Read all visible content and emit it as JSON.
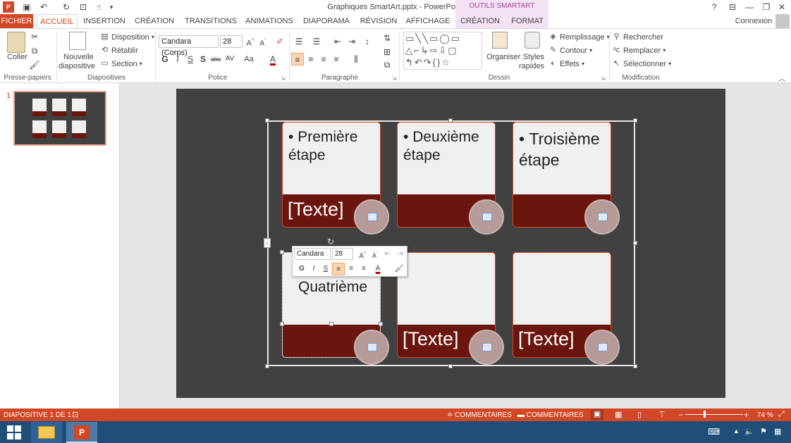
{
  "window": {
    "title": "Graphiques SmartArt.pptx - PowerPoint",
    "help": "?",
    "signin": "Connexion"
  },
  "tabs": {
    "file": "FICHIER",
    "home": "ACCUEIL",
    "insert": "INSERTION",
    "design": "CRÉATION",
    "transitions": "TRANSITIONS",
    "animations": "ANIMATIONS",
    "slideshow": "DIAPORAMA",
    "review": "RÉVISION",
    "view": "AFFICHAGE",
    "smartart_context": "OUTILS SMARTART",
    "smartart_design": "CRÉATION",
    "smartart_format": "FORMAT"
  },
  "ribbon": {
    "clipboard": {
      "paste": "Coller",
      "label": "Presse-papiers"
    },
    "slides": {
      "new_slide_line1": "Nouvelle",
      "new_slide_line2": "diapositive",
      "layout": "Disposition",
      "reset": "Rétablir",
      "section": "Section",
      "label": "Diapositives"
    },
    "font": {
      "font_name": "Candara (Corps)",
      "font_size": "28",
      "bold": "G",
      "italic": "I",
      "underline": "S",
      "shadow": "S",
      "strike": "abc",
      "spacing": "AV",
      "case": "Aa",
      "color": "A",
      "label": "Police"
    },
    "paragraph": {
      "label": "Paragraphe"
    },
    "drawing": {
      "arrange": "Organiser",
      "quick_styles_line1": "Styles",
      "quick_styles_line2": "rapides",
      "fill": "Remplissage",
      "outline": "Contour",
      "effects": "Effets",
      "label": "Dessin"
    },
    "editing": {
      "find": "Rechercher",
      "replace": "Remplacer",
      "select": "Sélectionner",
      "label": "Modification"
    }
  },
  "thumbnail": {
    "number": "1"
  },
  "slide": {
    "cards": [
      {
        "bullet": "Première étape",
        "placeholder": "[Texte]"
      },
      {
        "bullet": "Deuxième étape",
        "placeholder": ""
      },
      {
        "bullet": "Troisième étape",
        "placeholder": ""
      },
      {
        "bullet": "Quatrième",
        "placeholder": ""
      },
      {
        "bullet": "",
        "placeholder": "[Texte]"
      },
      {
        "bullet": "",
        "placeholder": "[Texte]"
      }
    ]
  },
  "mini_toolbar": {
    "font": "Candara",
    "size": "28",
    "bold": "G",
    "italic": "I",
    "underline": "S",
    "color": "A"
  },
  "status": {
    "slide_info": "DIAPOSITIVE 1 DE 1",
    "notes": "COMMENTAIRES",
    "comments": "COMMENTAIRES",
    "zoom": "74 %"
  },
  "colors": {
    "accent": "#d24726",
    "card_dark": "#6b150f",
    "slide_bg": "#414141",
    "taskbar": "#1f4e79"
  }
}
